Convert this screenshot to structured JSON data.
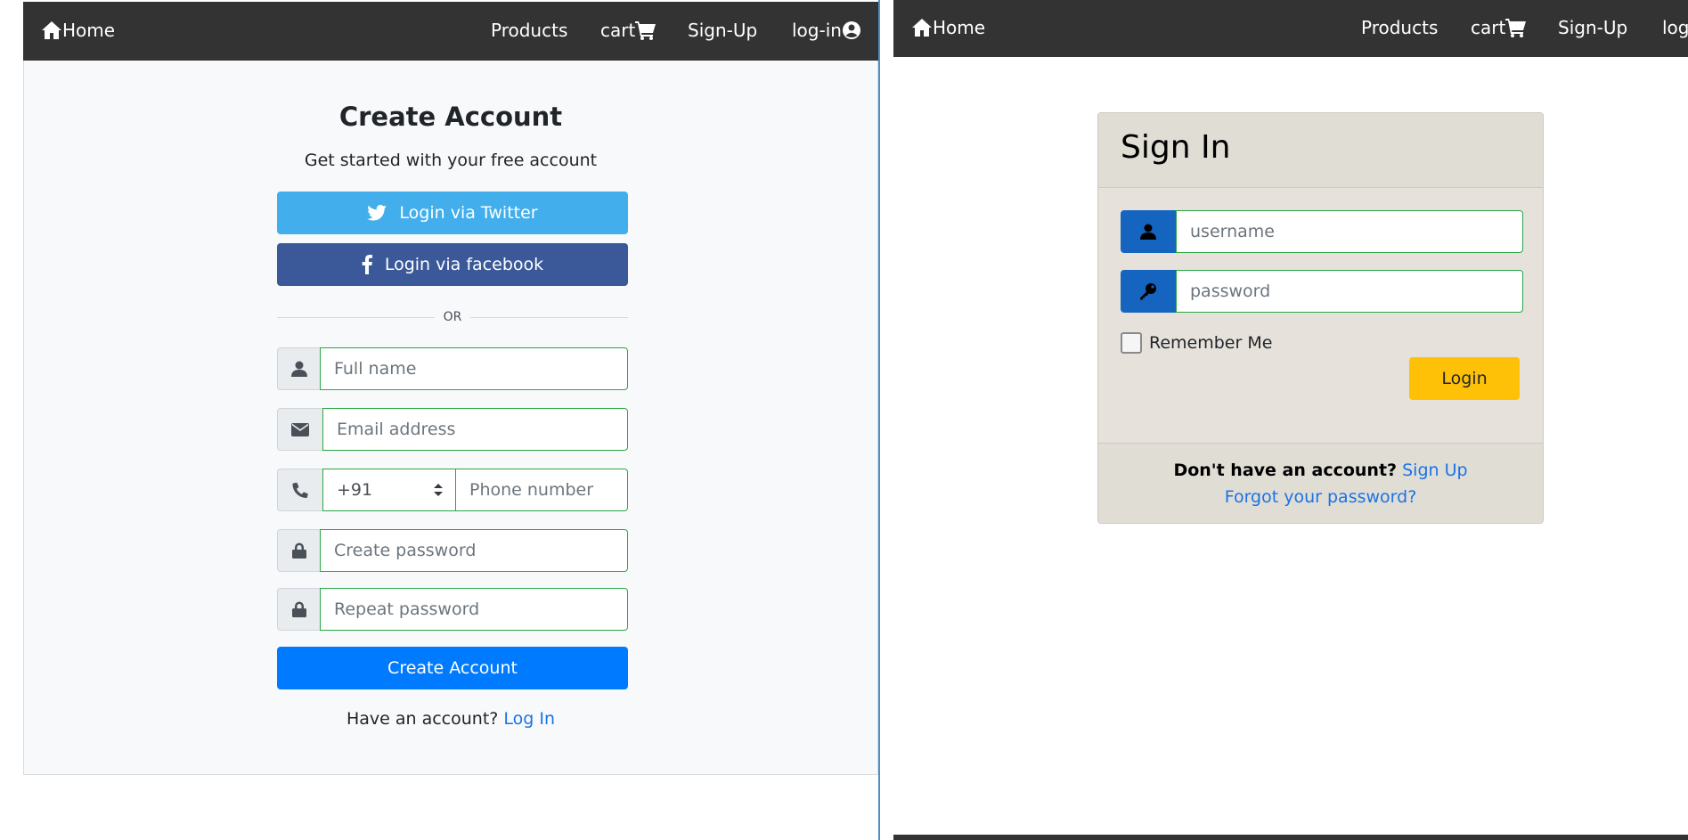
{
  "nav": {
    "home": "Home",
    "products": "Products",
    "cart": "cart",
    "signup": "Sign-Up",
    "login": "log-in",
    "login_cut": "log"
  },
  "signup_form": {
    "title": "Create Account",
    "subtitle": "Get started with your free account",
    "twitter_button": "Login via Twitter",
    "facebook_button": "Login via facebook",
    "or": "OR",
    "fullname_placeholder": "Full name",
    "email_placeholder": "Email address",
    "country_code": "+91",
    "phone_placeholder": "Phone number",
    "password_placeholder": "Create password",
    "repeat_password_placeholder": "Repeat password",
    "create_button": "Create Account",
    "have_account": "Have an account?",
    "login_link": "Log In"
  },
  "signin_form": {
    "title": "Sign In",
    "username_placeholder": "username",
    "password_placeholder": "password",
    "remember_me": "Remember Me",
    "login_button": "Login",
    "no_account": "Don't have an account?",
    "signup_link": "Sign Up",
    "forgot_link": "Forgot your password?"
  },
  "colors": {
    "navbar": "#333333",
    "twitter": "#42aeec",
    "facebook": "#3b5998",
    "primary": "#007bff",
    "warning": "#ffc107",
    "icon_blue": "#1565c0",
    "valid_border": "#28a745"
  }
}
